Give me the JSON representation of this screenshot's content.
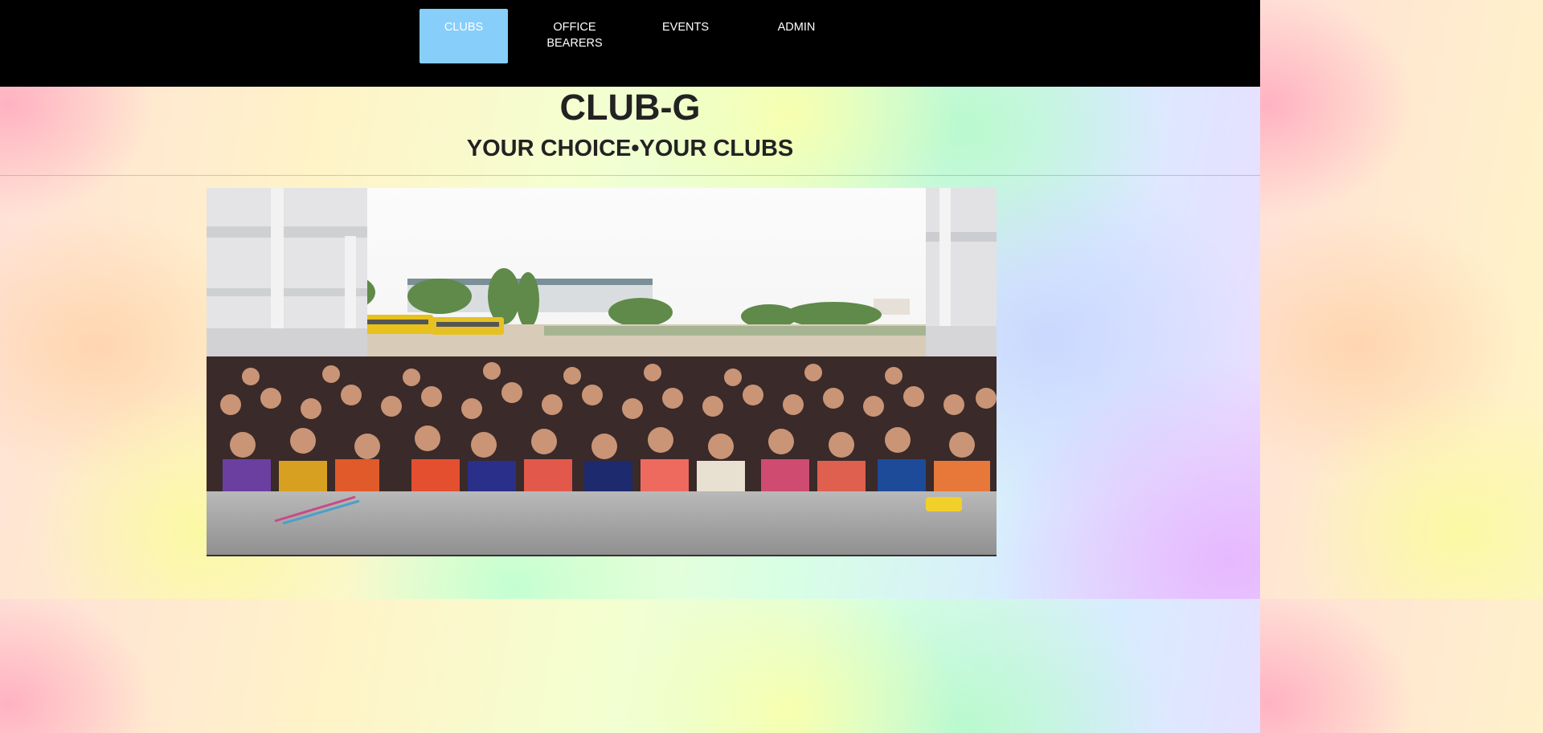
{
  "nav": {
    "items": [
      {
        "label": "CLUBS",
        "active": true
      },
      {
        "label": "OFFICE BEARERS",
        "active": false
      },
      {
        "label": "EVENTS",
        "active": false
      },
      {
        "label": "ADMIN",
        "active": false
      }
    ]
  },
  "header": {
    "title": "CLUB-G",
    "tagline": "YOUR CHOICE•YOUR CLUBS"
  },
  "colors": {
    "nav_background": "#000000",
    "nav_active": "#87cefa",
    "nav_text": "#ffffff",
    "heading_text": "#222222"
  }
}
